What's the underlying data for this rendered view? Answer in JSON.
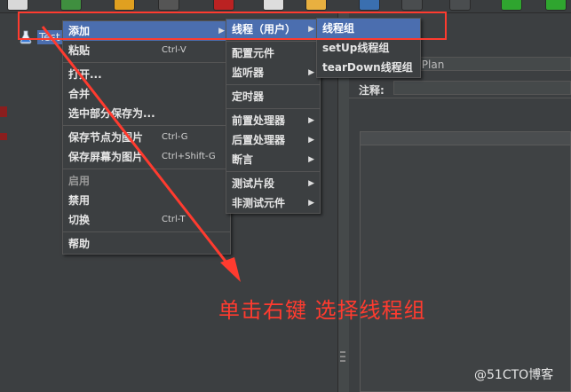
{
  "tree": {
    "root_label": "Test"
  },
  "right_panel": {
    "name_value": "st Plan",
    "comment_label": "注释:"
  },
  "context_menu": [
    {
      "label": "添加",
      "shortcut": "",
      "submenu": true,
      "selected": true
    },
    {
      "label": "粘贴",
      "shortcut": "Ctrl-V"
    },
    {
      "label": "打开...",
      "shortcut": ""
    },
    {
      "label": "合并",
      "shortcut": ""
    },
    {
      "label": "选中部分保存为...",
      "shortcut": ""
    },
    {
      "label": "保存节点为图片",
      "shortcut": "Ctrl-G"
    },
    {
      "label": "保存屏幕为图片",
      "shortcut": "Ctrl+Shift-G"
    },
    {
      "label": "启用",
      "shortcut": "",
      "disabled": true
    },
    {
      "label": "禁用",
      "shortcut": ""
    },
    {
      "label": "切换",
      "shortcut": "Ctrl-T"
    },
    {
      "label": "帮助",
      "shortcut": ""
    }
  ],
  "add_submenu": [
    {
      "label": "线程（用户）",
      "selected": true
    },
    {
      "label": "配置元件"
    },
    {
      "label": "监听器"
    },
    {
      "label": "定时器"
    },
    {
      "label": "前置处理器"
    },
    {
      "label": "后置处理器"
    },
    {
      "label": "断言"
    },
    {
      "label": "测试片段"
    },
    {
      "label": "非测试元件"
    }
  ],
  "thread_submenu": [
    {
      "label": "线程组",
      "selected": true
    },
    {
      "label": "setUp线程组"
    },
    {
      "label": "tearDown线程组"
    }
  ],
  "annotation": {
    "text": "单击右键  选择线程组",
    "color": "#ff3b2f"
  },
  "watermark": "@51CTO博客",
  "colors": {
    "menu_bg": "#3c3f41",
    "selection": "#4b6eaf",
    "annotation_red": "#ff3b2f"
  }
}
